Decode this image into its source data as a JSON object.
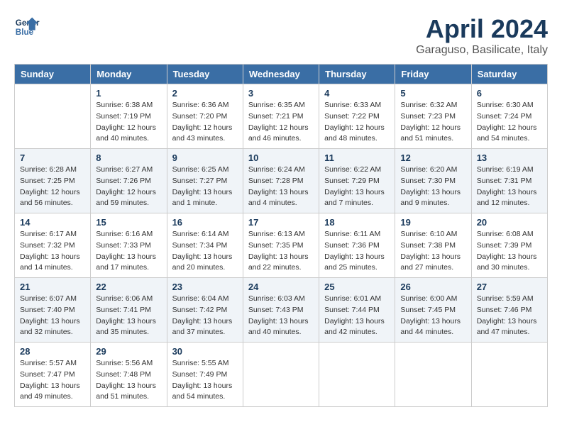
{
  "header": {
    "logo_line1": "General",
    "logo_line2": "Blue",
    "title": "April 2024",
    "subtitle": "Garaguso, Basilicate, Italy"
  },
  "calendar": {
    "days_of_week": [
      "Sunday",
      "Monday",
      "Tuesday",
      "Wednesday",
      "Thursday",
      "Friday",
      "Saturday"
    ],
    "weeks": [
      [
        {
          "day": "",
          "info": ""
        },
        {
          "day": "1",
          "info": "Sunrise: 6:38 AM\nSunset: 7:19 PM\nDaylight: 12 hours\nand 40 minutes."
        },
        {
          "day": "2",
          "info": "Sunrise: 6:36 AM\nSunset: 7:20 PM\nDaylight: 12 hours\nand 43 minutes."
        },
        {
          "day": "3",
          "info": "Sunrise: 6:35 AM\nSunset: 7:21 PM\nDaylight: 12 hours\nand 46 minutes."
        },
        {
          "day": "4",
          "info": "Sunrise: 6:33 AM\nSunset: 7:22 PM\nDaylight: 12 hours\nand 48 minutes."
        },
        {
          "day": "5",
          "info": "Sunrise: 6:32 AM\nSunset: 7:23 PM\nDaylight: 12 hours\nand 51 minutes."
        },
        {
          "day": "6",
          "info": "Sunrise: 6:30 AM\nSunset: 7:24 PM\nDaylight: 12 hours\nand 54 minutes."
        }
      ],
      [
        {
          "day": "7",
          "info": "Sunrise: 6:28 AM\nSunset: 7:25 PM\nDaylight: 12 hours\nand 56 minutes."
        },
        {
          "day": "8",
          "info": "Sunrise: 6:27 AM\nSunset: 7:26 PM\nDaylight: 12 hours\nand 59 minutes."
        },
        {
          "day": "9",
          "info": "Sunrise: 6:25 AM\nSunset: 7:27 PM\nDaylight: 13 hours\nand 1 minute."
        },
        {
          "day": "10",
          "info": "Sunrise: 6:24 AM\nSunset: 7:28 PM\nDaylight: 13 hours\nand 4 minutes."
        },
        {
          "day": "11",
          "info": "Sunrise: 6:22 AM\nSunset: 7:29 PM\nDaylight: 13 hours\nand 7 minutes."
        },
        {
          "day": "12",
          "info": "Sunrise: 6:20 AM\nSunset: 7:30 PM\nDaylight: 13 hours\nand 9 minutes."
        },
        {
          "day": "13",
          "info": "Sunrise: 6:19 AM\nSunset: 7:31 PM\nDaylight: 13 hours\nand 12 minutes."
        }
      ],
      [
        {
          "day": "14",
          "info": "Sunrise: 6:17 AM\nSunset: 7:32 PM\nDaylight: 13 hours\nand 14 minutes."
        },
        {
          "day": "15",
          "info": "Sunrise: 6:16 AM\nSunset: 7:33 PM\nDaylight: 13 hours\nand 17 minutes."
        },
        {
          "day": "16",
          "info": "Sunrise: 6:14 AM\nSunset: 7:34 PM\nDaylight: 13 hours\nand 20 minutes."
        },
        {
          "day": "17",
          "info": "Sunrise: 6:13 AM\nSunset: 7:35 PM\nDaylight: 13 hours\nand 22 minutes."
        },
        {
          "day": "18",
          "info": "Sunrise: 6:11 AM\nSunset: 7:36 PM\nDaylight: 13 hours\nand 25 minutes."
        },
        {
          "day": "19",
          "info": "Sunrise: 6:10 AM\nSunset: 7:38 PM\nDaylight: 13 hours\nand 27 minutes."
        },
        {
          "day": "20",
          "info": "Sunrise: 6:08 AM\nSunset: 7:39 PM\nDaylight: 13 hours\nand 30 minutes."
        }
      ],
      [
        {
          "day": "21",
          "info": "Sunrise: 6:07 AM\nSunset: 7:40 PM\nDaylight: 13 hours\nand 32 minutes."
        },
        {
          "day": "22",
          "info": "Sunrise: 6:06 AM\nSunset: 7:41 PM\nDaylight: 13 hours\nand 35 minutes."
        },
        {
          "day": "23",
          "info": "Sunrise: 6:04 AM\nSunset: 7:42 PM\nDaylight: 13 hours\nand 37 minutes."
        },
        {
          "day": "24",
          "info": "Sunrise: 6:03 AM\nSunset: 7:43 PM\nDaylight: 13 hours\nand 40 minutes."
        },
        {
          "day": "25",
          "info": "Sunrise: 6:01 AM\nSunset: 7:44 PM\nDaylight: 13 hours\nand 42 minutes."
        },
        {
          "day": "26",
          "info": "Sunrise: 6:00 AM\nSunset: 7:45 PM\nDaylight: 13 hours\nand 44 minutes."
        },
        {
          "day": "27",
          "info": "Sunrise: 5:59 AM\nSunset: 7:46 PM\nDaylight: 13 hours\nand 47 minutes."
        }
      ],
      [
        {
          "day": "28",
          "info": "Sunrise: 5:57 AM\nSunset: 7:47 PM\nDaylight: 13 hours\nand 49 minutes."
        },
        {
          "day": "29",
          "info": "Sunrise: 5:56 AM\nSunset: 7:48 PM\nDaylight: 13 hours\nand 51 minutes."
        },
        {
          "day": "30",
          "info": "Sunrise: 5:55 AM\nSunset: 7:49 PM\nDaylight: 13 hours\nand 54 minutes."
        },
        {
          "day": "",
          "info": ""
        },
        {
          "day": "",
          "info": ""
        },
        {
          "day": "",
          "info": ""
        },
        {
          "day": "",
          "info": ""
        }
      ]
    ]
  }
}
